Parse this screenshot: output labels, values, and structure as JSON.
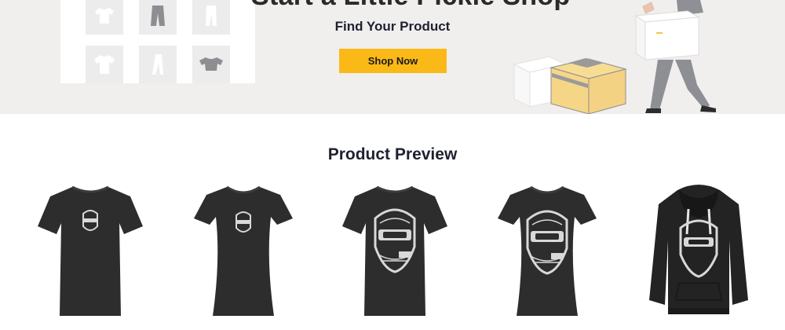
{
  "hero": {
    "headline": "Start a Little Pickle Shop",
    "subtitle": "Find Your Product",
    "shop_button": "Shop Now"
  },
  "preview": {
    "title": "Product Preview",
    "products": [
      {
        "kind": "mens-tshirt",
        "icon": "tshirt-icon"
      },
      {
        "kind": "womens-tshirt",
        "icon": "tshirt-icon"
      },
      {
        "kind": "mens-tshirt-large-print",
        "icon": "tshirt-icon"
      },
      {
        "kind": "womens-tshirt-large-print",
        "icon": "tshirt-icon"
      },
      {
        "kind": "hoodie",
        "icon": "hoodie-icon"
      }
    ]
  },
  "colors": {
    "hero_bg": "#f0efee",
    "button": "#fbb917",
    "garment": "#2d2d2d",
    "heading": "#1f2130"
  }
}
